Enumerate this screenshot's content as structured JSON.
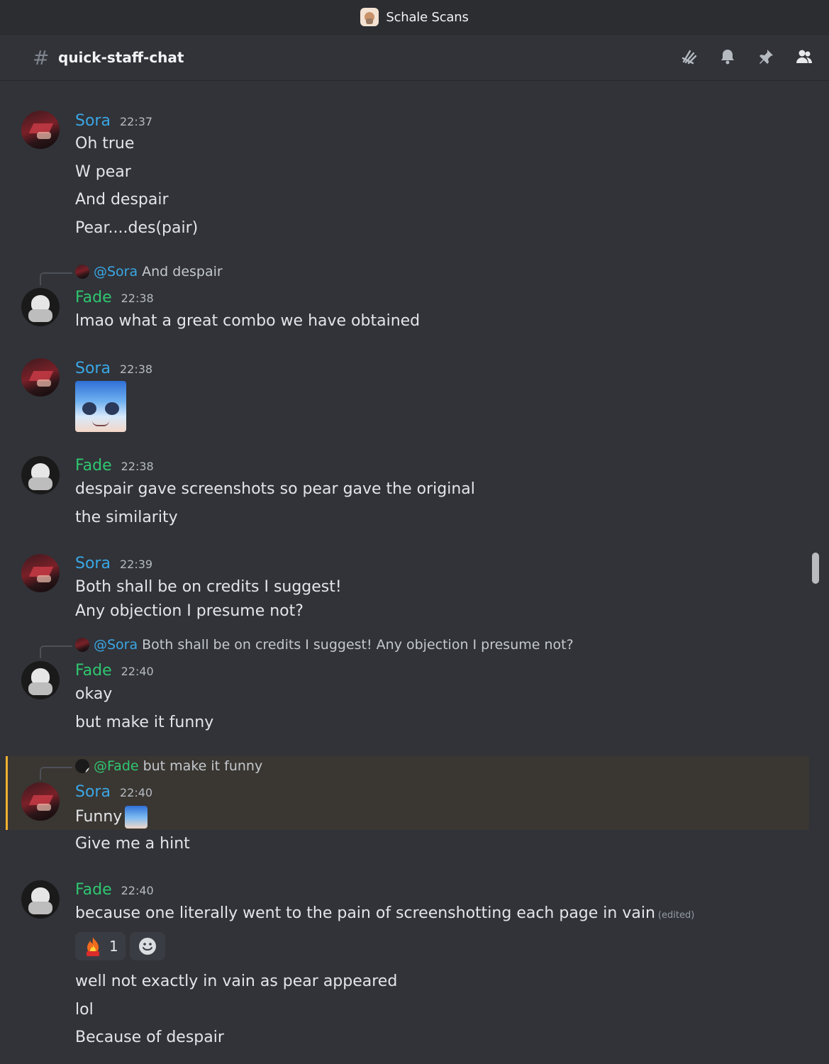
{
  "window": {
    "server_name": "Schale Scans"
  },
  "channel": {
    "name": "quick-staff-chat"
  },
  "colors": {
    "sora": "#3aa7e6",
    "fade": "#2fc770",
    "highlight_bar": "#f0b232"
  },
  "icons": [
    "threads-icon",
    "bell-icon",
    "pin-icon",
    "members-icon"
  ],
  "messages": [
    {
      "author": "Sora",
      "time": "22:37",
      "lines": [
        "Oh true",
        "W pear",
        "And despair",
        "Pear....des(pair)"
      ]
    },
    {
      "reply": {
        "mention": "@Sora",
        "text": "And despair"
      },
      "author": "Fade",
      "time": "22:38",
      "lines": [
        "lmao what a great combo we have obtained"
      ]
    },
    {
      "author": "Sora",
      "time": "22:38",
      "sticker": "anime-sticker"
    },
    {
      "author": "Fade",
      "time": "22:38",
      "lines": [
        "despair gave screenshots so pear gave the original",
        "the similarity"
      ]
    },
    {
      "author": "Sora",
      "time": "22:39",
      "lines": [
        "Both shall be on credits I suggest!",
        "Any objection I presume not?"
      ]
    },
    {
      "reply": {
        "mention": "@Sora",
        "text": "Both shall be on credits I suggest! Any objection I presume not?"
      },
      "author": "Fade",
      "time": "22:40",
      "lines": [
        "okay",
        "but make it funny"
      ]
    },
    {
      "reply": {
        "mention": "@Fade",
        "text": "but make it funny"
      },
      "author": "Sora",
      "time": "22:40",
      "lines": [
        "Funny",
        "Give me a hint"
      ]
    },
    {
      "author": "Fade",
      "time": "22:40",
      "lines": [
        "because one literally went to the pain of screenshotting each page in vain",
        "well not exactly in vain as pear appeared",
        "lol",
        "Because of despair"
      ],
      "edited": "(edited)",
      "reaction": {
        "count": "1"
      }
    }
  ]
}
